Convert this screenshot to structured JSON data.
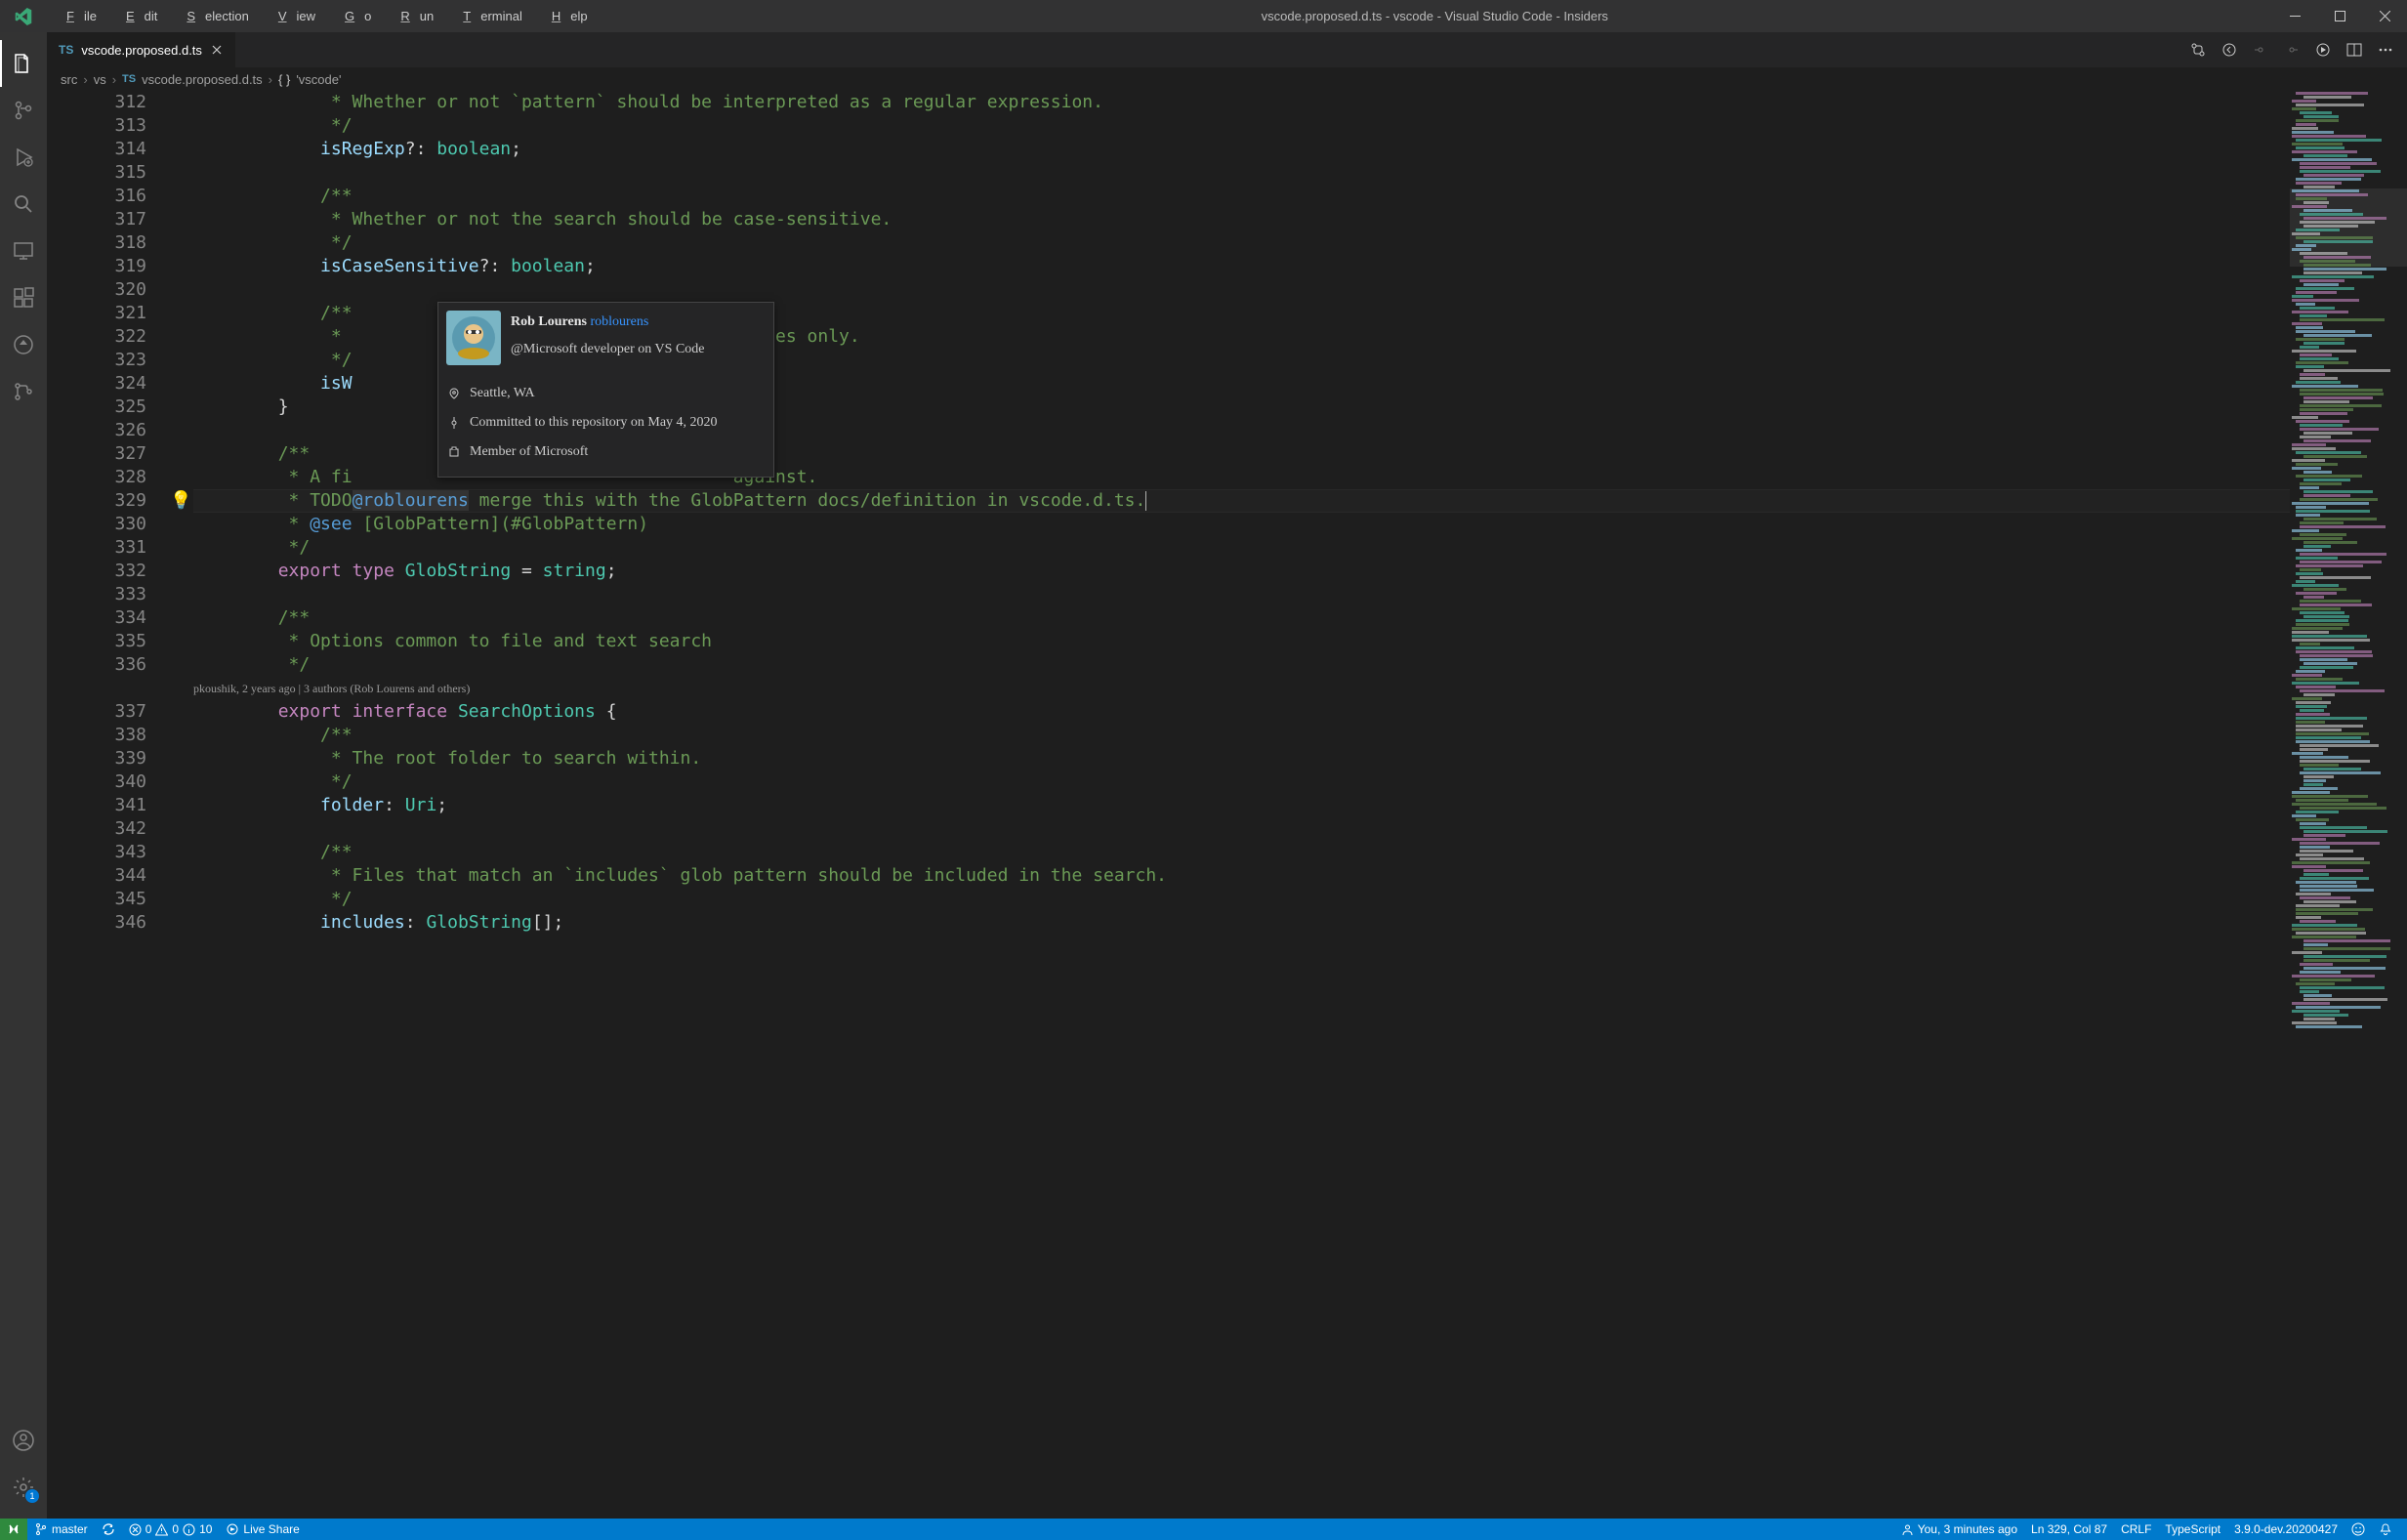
{
  "title": "vscode.proposed.d.ts - vscode - Visual Studio Code - Insiders",
  "menu": {
    "file": "File",
    "edit": "Edit",
    "selection": "Selection",
    "view": "View",
    "go": "Go",
    "run": "Run",
    "terminal": "Terminal",
    "help": "Help"
  },
  "tab": {
    "filename": "vscode.proposed.d.ts"
  },
  "breadcrumb": {
    "p0": "src",
    "p1": "vs",
    "p2": "vscode.proposed.d.ts",
    "p3": "{ }",
    "p4": "'vscode'"
  },
  "gutter": {
    "start": 312,
    "end": 346
  },
  "code": {
    "l312": " * Whether or not `pattern` should be interpreted as a regular expression.",
    "l313": " */",
    "l314_prop": "isRegExp",
    "l314_q": "?: ",
    "l314_type": "boolean",
    "l314_s": ";",
    "l316": "/**",
    "l317": " * Whether or not the search should be case-sensitive.",
    "l318": " */",
    "l319_prop": "isCaseSensitive",
    "l319_q": "?: ",
    "l319_type": "boolean",
    "l319_s": ";",
    "l321": "/**",
    "l322": " * ",
    "l322_tail": "rd matches only.",
    "l323": " */",
    "l324_prop": "isW",
    "l325": "}",
    "l327": "/**",
    "l328": " * A fi",
    "l328_tail": "against.",
    "l329_a": " * ",
    "l329_todo": "TODO",
    "l329_at": "@roblourens",
    "l329_msg": " merge this with the GlobPattern docs/definition in vscode.d.ts.",
    "l330_a": " * ",
    "l330_see": "@see",
    "l330_lb": " [",
    "l330_gp": "GlobPattern",
    "l330_mid": "](#",
    "l330_gp2": "GlobPattern",
    "l330_end": ")",
    "l331": " */",
    "l332_exp": "export",
    "l332_type": "type",
    "l332_name": "GlobString",
    "l332_eq": " = ",
    "l332_str": "string",
    "l332_s": ";",
    "l334": "/**",
    "l335": " * Options common to file and text search",
    "l336": " */",
    "codelens": "pkoushik, 2 years ago | 3 authors (Rob Lourens and others)",
    "l337_exp": "export",
    "l337_int": "interface",
    "l337_name": "SearchOptions",
    "l337_b": " {",
    "l338": "/**",
    "l339": " * The root folder to search within.",
    "l340": " */",
    "l341_prop": "folder",
    "l341_c": ": ",
    "l341_type": "Uri",
    "l341_s": ";",
    "l343": "/**",
    "l344": " * Files that match an `includes` glob pattern should be included in the search.",
    "l345": " */",
    "l346_prop": "includes",
    "l346_c": ": ",
    "l346_type": "GlobString",
    "l346_b": "[];"
  },
  "hover": {
    "name": "Rob Lourens",
    "handle": "roblourens",
    "bio": "@Microsoft developer on VS Code",
    "location": "Seattle, WA",
    "commit": "Committed to this repository on May 4, 2020",
    "org": "Member of Microsoft"
  },
  "status": {
    "branch": "master",
    "errors": "0",
    "warnings": "0",
    "info": "10",
    "liveshare": "Live Share",
    "blame": "You, 3 minutes ago",
    "lncol": "Ln 329, Col 87",
    "eol": "CRLF",
    "lang": "TypeScript",
    "tsver": "3.9.0-dev.20200427"
  },
  "activity_badge": "1"
}
